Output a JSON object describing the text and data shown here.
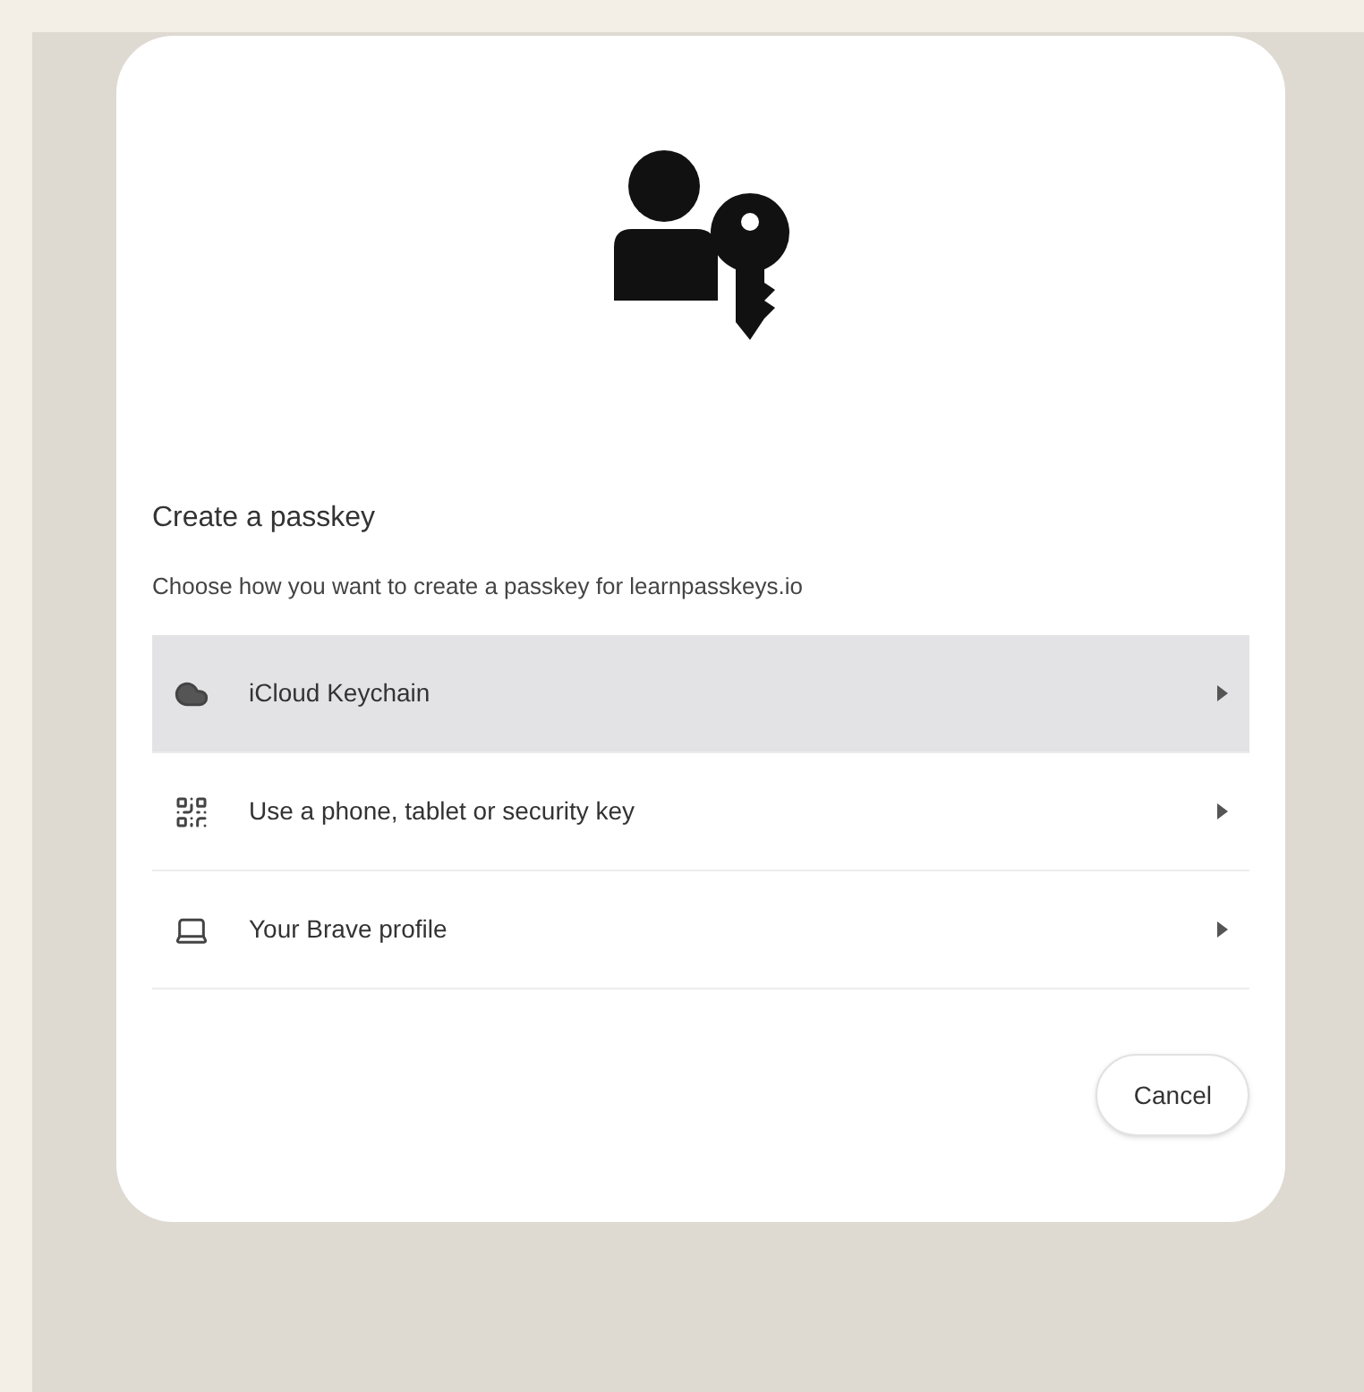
{
  "dialog": {
    "title": "Create a passkey",
    "subtitle": "Choose how you want to create a passkey for learnpasskeys.io"
  },
  "options": [
    {
      "kind": "cloud",
      "label": "iCloud Keychain",
      "selected": true
    },
    {
      "kind": "phone",
      "label": "Use a phone, tablet or security key",
      "selected": false
    },
    {
      "kind": "laptop",
      "label": "Your Brave profile",
      "selected": false
    }
  ],
  "buttons": [
    "Cancel"
  ]
}
